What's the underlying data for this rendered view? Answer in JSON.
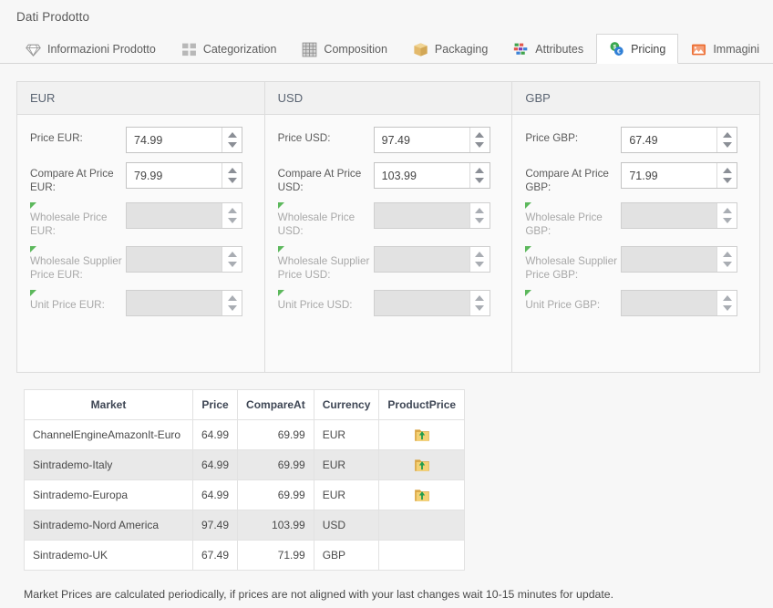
{
  "page": {
    "title": "Dati Prodotto"
  },
  "tabs": [
    {
      "label": "Informazioni Prodotto",
      "icon": "diamond-icon",
      "active": false
    },
    {
      "label": "Categorization",
      "icon": "grid-squares-icon",
      "active": false
    },
    {
      "label": "Composition",
      "icon": "weave-pattern-icon",
      "active": false
    },
    {
      "label": "Packaging",
      "icon": "box-icon",
      "active": false
    },
    {
      "label": "Attributes",
      "icon": "color-blocks-icon",
      "active": false
    },
    {
      "label": "Pricing",
      "icon": "coins-icon",
      "active": true
    },
    {
      "label": "Immagini",
      "icon": "image-icon",
      "active": false
    }
  ],
  "panels": [
    {
      "currency": "EUR",
      "fields": [
        {
          "label": "Price EUR:",
          "value": "74.99",
          "disabled": false,
          "flag": false
        },
        {
          "label": "Compare At Price EUR:",
          "value": "79.99",
          "disabled": false,
          "flag": false
        },
        {
          "label": "Wholesale Price EUR:",
          "value": "",
          "disabled": true,
          "flag": true
        },
        {
          "label": "Wholesale Supplier Price EUR:",
          "value": "",
          "disabled": true,
          "flag": true
        },
        {
          "label": "Unit Price EUR:",
          "value": "",
          "disabled": true,
          "flag": true
        }
      ]
    },
    {
      "currency": "USD",
      "fields": [
        {
          "label": "Price USD:",
          "value": "97.49",
          "disabled": false,
          "flag": false
        },
        {
          "label": "Compare At Price USD:",
          "value": "103.99",
          "disabled": false,
          "flag": false
        },
        {
          "label": "Wholesale Price USD:",
          "value": "",
          "disabled": true,
          "flag": true
        },
        {
          "label": "Wholesale Supplier Price USD:",
          "value": "",
          "disabled": true,
          "flag": true
        },
        {
          "label": "Unit Price USD:",
          "value": "",
          "disabled": true,
          "flag": true
        }
      ]
    },
    {
      "currency": "GBP",
      "fields": [
        {
          "label": "Price GBP:",
          "value": "67.49",
          "disabled": false,
          "flag": false
        },
        {
          "label": "Compare At Price GBP:",
          "value": "71.99",
          "disabled": false,
          "flag": false
        },
        {
          "label": "Wholesale Price GBP:",
          "value": "",
          "disabled": true,
          "flag": true
        },
        {
          "label": "Wholesale Supplier Price GBP:",
          "value": "",
          "disabled": true,
          "flag": true
        },
        {
          "label": "Unit Price GBP:",
          "value": "",
          "disabled": true,
          "flag": true
        }
      ]
    }
  ],
  "market_table": {
    "columns": [
      "Market",
      "Price",
      "CompareAt",
      "Currency",
      "ProductPrice"
    ],
    "rows": [
      {
        "market": "ChannelEngineAmazonIt-Euro",
        "price": "64.99",
        "compare_at": "69.99",
        "currency": "EUR",
        "product_price_icon": "folder-upload-icon"
      },
      {
        "market": "Sintrademo-Italy",
        "price": "64.99",
        "compare_at": "69.99",
        "currency": "EUR",
        "product_price_icon": "folder-upload-icon"
      },
      {
        "market": "Sintrademo-Europa",
        "price": "64.99",
        "compare_at": "69.99",
        "currency": "EUR",
        "product_price_icon": "folder-upload-icon"
      },
      {
        "market": "Sintrademo-Nord America",
        "price": "97.49",
        "compare_at": "103.99",
        "currency": "USD",
        "product_price_icon": ""
      },
      {
        "market": "Sintrademo-UK",
        "price": "67.49",
        "compare_at": "71.99",
        "currency": "GBP",
        "product_price_icon": ""
      }
    ]
  },
  "note": "Market Prices are calculated periodically, if prices are not aligned with your last changes wait 10-15 minutes for update.",
  "colors": {
    "page_background": "#f7f7f7",
    "panel_header_background": "#f1f1f1",
    "border": "#dcdcdc",
    "flag_green": "#5cb85c",
    "active_tab_background": "#ffffff",
    "folder_yellow": "#f2ce68",
    "folder_arrow_green": "#26a65b",
    "text": "#555555"
  }
}
